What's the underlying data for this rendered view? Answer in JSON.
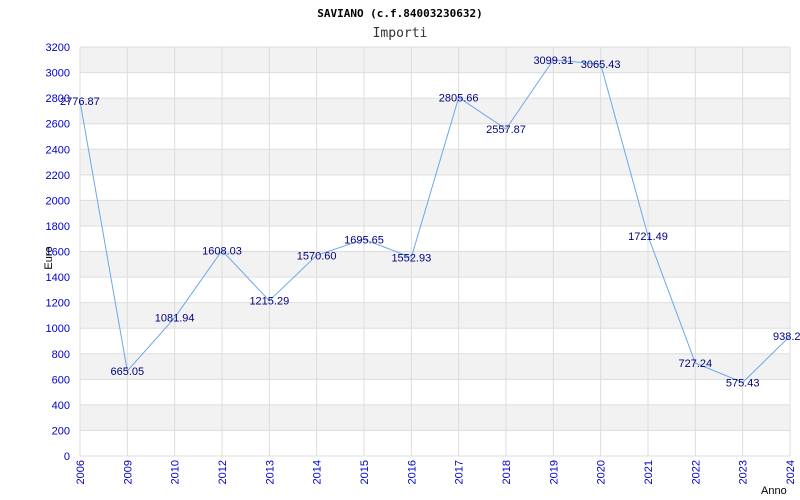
{
  "chart_data": {
    "type": "line",
    "title": "SAVIANO (c.f.84003230632)",
    "subtitle": "Importi",
    "ylabel": "Euro",
    "xlabel": "Anno",
    "ylim": [
      0,
      3200
    ],
    "ytick_step": 200,
    "grid": true,
    "categories": [
      "2006",
      "2009",
      "2010",
      "2012",
      "2013",
      "2014",
      "2015",
      "2016",
      "2017",
      "2018",
      "2019",
      "2020",
      "2021",
      "2022",
      "2023",
      "2024"
    ],
    "series": [
      {
        "values": [
          2776.87,
          665.05,
          1081.94,
          1608.03,
          1215.29,
          1570.6,
          1695.65,
          1552.93,
          2805.66,
          2557.87,
          3099.31,
          3065.43,
          1721.49,
          727.24,
          575.43,
          938.2
        ],
        "labels": [
          "2776.87",
          "665.05",
          "1081.94",
          "1608.03",
          "1215.29",
          "1570.60",
          "1695.65",
          "1552.93",
          "2805.66",
          "2557.87",
          "3099.31",
          "3065.43",
          "1721.49",
          "727.24",
          "575.43",
          "938.2"
        ]
      }
    ],
    "colors": {
      "line": "#6aa9e9",
      "band": "#f2f2f2",
      "grid": "#dddddd",
      "tick_text": "#0000cc",
      "label_text": "#000080"
    }
  }
}
